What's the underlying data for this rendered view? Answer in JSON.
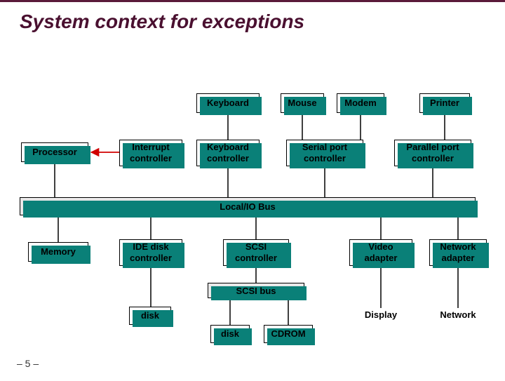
{
  "title": "System context for exceptions",
  "footer": "– 5 –",
  "boxes": {
    "keyboard": "Keyboard",
    "mouse": "Mouse",
    "modem": "Modem",
    "printer": "Printer",
    "processor": "Processor",
    "intctrl": "Interrupt controller",
    "kbctrl": "Keyboard controller",
    "serial": "Serial port controller",
    "parallel": "Parallel port controller",
    "bus": "Local/IO Bus",
    "memory": "Memory",
    "idectrl": "IDE disk controller",
    "scsictrl": "SCSI controller",
    "video": "Video adapter",
    "netadpt": "Network adapter",
    "scsibus": "SCSI bus",
    "disk1": "disk",
    "disk2": "disk",
    "cdrom": "CDROM",
    "display": "Display",
    "network": "Network"
  },
  "connections": [
    {
      "from": "keyboard",
      "to": "kbctrl"
    },
    {
      "from": "mouse",
      "to": "serial"
    },
    {
      "from": "modem",
      "to": "serial"
    },
    {
      "from": "printer",
      "to": "parallel"
    },
    {
      "from": "kbctrl",
      "to": "intctrl",
      "arrow": "red"
    },
    {
      "from": "serial",
      "to": "intctrl",
      "arrow": "red"
    },
    {
      "from": "parallel",
      "to": "intctrl",
      "arrow": "red"
    },
    {
      "from": "intctrl",
      "to": "processor",
      "arrow": "red"
    },
    {
      "from": "processor",
      "to": "bus"
    },
    {
      "from": "kbctrl",
      "to": "bus"
    },
    {
      "from": "serial",
      "to": "bus"
    },
    {
      "from": "parallel",
      "to": "bus"
    },
    {
      "from": "memory",
      "to": "bus"
    },
    {
      "from": "idectrl",
      "to": "bus"
    },
    {
      "from": "scsictrl",
      "to": "bus"
    },
    {
      "from": "video",
      "to": "bus"
    },
    {
      "from": "netadpt",
      "to": "bus"
    },
    {
      "from": "idectrl",
      "to": "disk1"
    },
    {
      "from": "scsictrl",
      "to": "scsibus"
    },
    {
      "from": "disk2",
      "to": "scsibus"
    },
    {
      "from": "cdrom",
      "to": "scsibus"
    },
    {
      "from": "video",
      "to": "display"
    },
    {
      "from": "netadpt",
      "to": "network"
    }
  ]
}
